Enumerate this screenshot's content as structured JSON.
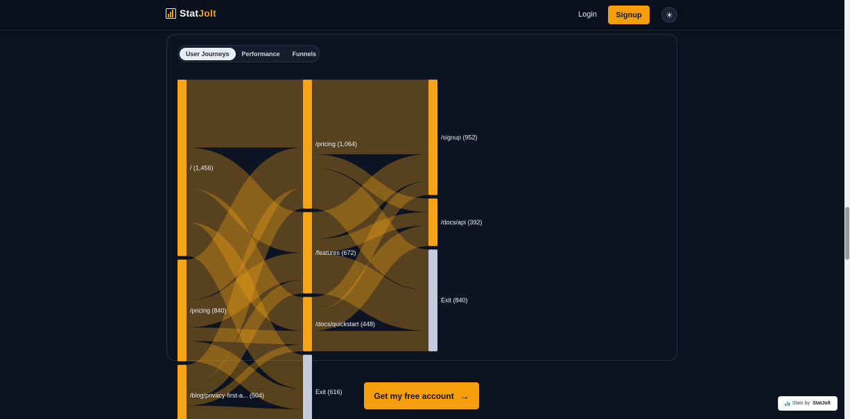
{
  "brand": {
    "name_part1": "Stat",
    "name_part2": "Jolt",
    "accent": "#f59e0b"
  },
  "nav": {
    "login_label": "Login",
    "signup_label": "Signup",
    "theme_icon": "sun-icon"
  },
  "tabs": [
    {
      "label": "User Journeys",
      "active": true
    },
    {
      "label": "Performance",
      "active": false
    },
    {
      "label": "Funnels",
      "active": false
    }
  ],
  "chart_data": {
    "type": "sankey",
    "columns": [
      [
        {
          "id": "home",
          "label": "/ (1,456)",
          "value": 1456,
          "color": "#f5a416"
        },
        {
          "id": "pricing0",
          "label": "/pricing (840)",
          "value": 840,
          "color": "#f5a416"
        },
        {
          "id": "blog",
          "label": "/blog/privacy-first-a... (504)",
          "value": 504,
          "color": "#f5a416"
        }
      ],
      [
        {
          "id": "pricing1",
          "label": "/pricing (1,064)",
          "value": 1064,
          "color": "#f5a416"
        },
        {
          "id": "features",
          "label": "/features (672)",
          "value": 672,
          "color": "#f5a416"
        },
        {
          "id": "quickstart",
          "label": "/docs/quickstart (448)",
          "value": 448,
          "color": "#f5a416"
        },
        {
          "id": "exit1",
          "label": "Exit (616)",
          "value": 616,
          "color": "#c3cbdd"
        }
      ],
      [
        {
          "id": "signup",
          "label": "/signup (952)",
          "value": 952,
          "color": "#f5a416"
        },
        {
          "id": "docsapi",
          "label": "/docs/api (392)",
          "value": 392,
          "color": "#f5a416"
        },
        {
          "id": "exit2",
          "label": "Exit (840)",
          "value": 840,
          "color": "#c3cbdd"
        }
      ]
    ],
    "links": [
      {
        "source": "home",
        "target": "pricing1",
        "value": 560
      },
      {
        "source": "home",
        "target": "features",
        "value": 336
      },
      {
        "source": "home",
        "target": "quickstart",
        "value": 280
      },
      {
        "source": "home",
        "target": "exit1",
        "value": 280
      },
      {
        "source": "pricing0",
        "target": "pricing1",
        "value": 336
      },
      {
        "source": "pricing0",
        "target": "features",
        "value": 224
      },
      {
        "source": "pricing0",
        "target": "quickstart",
        "value": 112
      },
      {
        "source": "pricing0",
        "target": "exit1",
        "value": 168
      },
      {
        "source": "blog",
        "target": "pricing1",
        "value": 168
      },
      {
        "source": "blog",
        "target": "features",
        "value": 112
      },
      {
        "source": "blog",
        "target": "quickstart",
        "value": 56
      },
      {
        "source": "blog",
        "target": "exit1",
        "value": 168
      },
      {
        "source": "pricing1",
        "target": "signup",
        "value": 616
      },
      {
        "source": "pricing1",
        "target": "docsapi",
        "value": 112
      },
      {
        "source": "pricing1",
        "target": "exit2",
        "value": 336
      },
      {
        "source": "features",
        "target": "signup",
        "value": 224
      },
      {
        "source": "features",
        "target": "docsapi",
        "value": 112
      },
      {
        "source": "features",
        "target": "exit2",
        "value": 336
      },
      {
        "source": "quickstart",
        "target": "signup",
        "value": 112
      },
      {
        "source": "quickstart",
        "target": "docsapi",
        "value": 168
      },
      {
        "source": "quickstart",
        "target": "exit2",
        "value": 168
      }
    ],
    "link_color": "#f5a416"
  },
  "cta": {
    "label": "Get my free account",
    "arrow_icon": "arrow-right-icon"
  },
  "badge": {
    "prefix": "Stats by",
    "brand": "StatJolt"
  }
}
